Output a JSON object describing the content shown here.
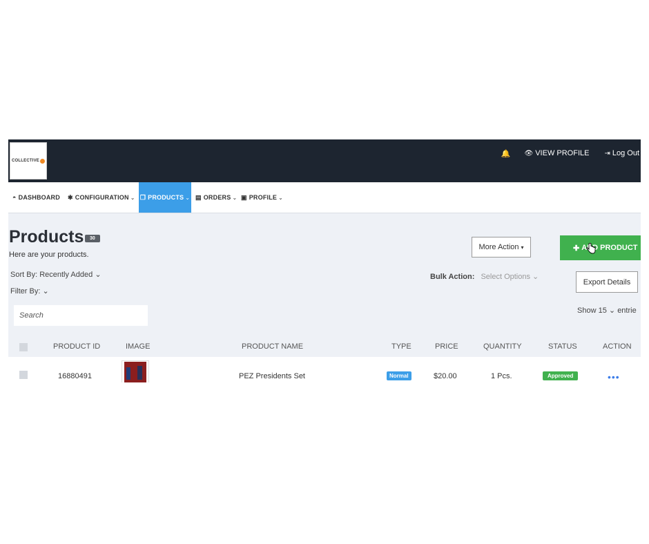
{
  "logo": {
    "text": "COLLECTIVE"
  },
  "topbar": {
    "view_profile": "VIEW PROFILE",
    "log_out": "Log Out"
  },
  "nav": {
    "dashboard": "DASHBOARD",
    "configuration": "CONFIGURATION",
    "products": "PRODUCTS",
    "orders": "ORDERS",
    "profile": "PROFILE"
  },
  "page": {
    "title": "Products",
    "count": "30",
    "subtitle": "Here are your products."
  },
  "controls": {
    "sort_label": "Sort By:",
    "sort_value": "Recently Added",
    "filter_label": "Filter By:",
    "more_action": "More Action",
    "add_product": "ADD PRODUCT",
    "bulk_label": "Bulk Action:",
    "bulk_value": "Select Options",
    "export": "Export Details",
    "search_placeholder": "Search",
    "show_label": "Show",
    "show_value": "15",
    "entries_label": "entrie"
  },
  "table": {
    "headers": {
      "id": "PRODUCT ID",
      "image": "IMAGE",
      "name": "PRODUCT NAME",
      "type": "TYPE",
      "price": "PRICE",
      "quantity": "QUANTITY",
      "status": "STATUS",
      "action": "ACTION"
    },
    "rows": [
      {
        "id": "16880491",
        "name": "PEZ Presidents Set",
        "type": "Normal",
        "price": "$20.00",
        "quantity": "1 Pcs.",
        "status": "Approved",
        "action": "•••"
      }
    ]
  },
  "colors": {
    "topbar": "#1d2530",
    "accent": "#3c9ee8",
    "success": "#40b14e"
  }
}
